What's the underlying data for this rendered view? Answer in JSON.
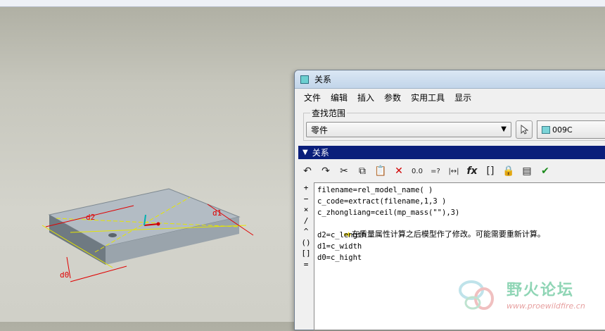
{
  "model": {
    "dimensions": [
      "d2",
      "d1",
      "d0"
    ]
  },
  "dialog": {
    "title": "关系",
    "menus": [
      "文件",
      "编辑",
      "插入",
      "参数",
      "实用工具",
      "显示"
    ],
    "scope_label": "查找范围",
    "scope_select": "零件",
    "part_name": "009C",
    "section_title": "关系",
    "toolbar": {
      "undo": "↶",
      "redo": "↷",
      "cut": "✂",
      "copy": "⧉",
      "paste": "📋",
      "delete": "✕",
      "num": "0.0",
      "eval": "=?",
      "dimension": "|↔|",
      "fx": "fx",
      "brackets": "[]",
      "tool_a": "🔒",
      "tool_b": "▤",
      "tool_c": "✔"
    },
    "side_symbols": [
      "+",
      "−",
      "×",
      "/",
      "^",
      "()",
      "[]",
      "="
    ],
    "code_lines": [
      "filename=rel_model_name( )",
      "c_code=extract(filename,1,3 )",
      "c_zhongliang=ceil(mp_mass(\"\"),3)",
      "",
      "d2=c_length",
      "d1=c_width",
      "d0=c_hight"
    ],
    "warning": "在质量属性计算之后模型作了修改。可能需要重新计算。"
  },
  "watermark": {
    "title": "野火论坛",
    "url": "www.proewildfire.cn"
  }
}
